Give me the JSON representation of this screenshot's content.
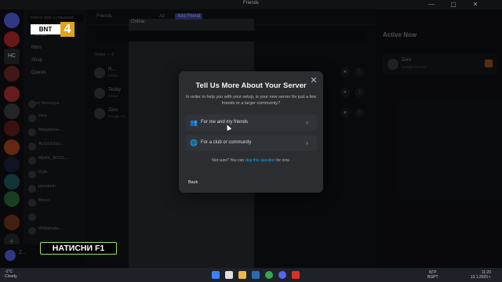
{
  "window": {
    "title": "Friends",
    "minimize": "—",
    "maximize": "▢",
    "close": "✕"
  },
  "server_rail": {
    "items": [
      "",
      "HC",
      "",
      "",
      "",
      "",
      "",
      "",
      "",
      "",
      "",
      "",
      "",
      "",
      ""
    ],
    "add": "+"
  },
  "sidebar": {
    "find_placeholder": "Find or start a conversati...",
    "nav": [
      "Friends",
      "Nitro",
      "Shop",
      "Quests"
    ],
    "dm_header": "Direct Messages",
    "dms": [
      {
        "name": "",
        "status": ""
      },
      {
        "name": "Zero",
        "status": ""
      },
      {
        "name": "Bloodemer...",
        "status": ""
      },
      {
        "name": "AUUUUUU...",
        "status": ""
      },
      {
        "name": "Mystic_BOUL...",
        "status": ""
      },
      {
        "name": "Oyte",
        "status": ""
      },
      {
        "name": "jasnamin",
        "status": ""
      },
      {
        "name": "Bloso",
        "status": ""
      },
      {
        "name": "",
        "status": ""
      },
      {
        "name": "Williamster...",
        "status": ""
      }
    ]
  },
  "user_panel": {
    "name": "Z..."
  },
  "topbar": {
    "friends": "Friends",
    "online": "Online",
    "all": "All",
    "add_friend": "Add Friend"
  },
  "friends": {
    "online_count": "Online — 3",
    "rows": [
      {
        "name": "R...",
        "status": "Online"
      },
      {
        "name": "Teddy",
        "status": "Online"
      },
      {
        "name": "Zero",
        "status": "Google Ch..."
      }
    ]
  },
  "active_now": {
    "title": "Active Now",
    "card": {
      "name": "Zero",
      "status": "Google Chrome"
    }
  },
  "modal": {
    "title": "Tell Us More About Your Server",
    "description": "In order to help you with your setup, is your new server for just a few friends or a larger community?",
    "options": [
      {
        "label": "For me and my friends",
        "icon": "👥"
      },
      {
        "label": "For a club or community",
        "icon": "🌐"
      }
    ],
    "note_prefix": "Not sure? You can ",
    "note_link": "skip this question",
    "note_suffix": " for now.",
    "back": "Back",
    "close": "✕",
    "chevron": "›"
  },
  "overlays": {
    "bnt_text": "BNT",
    "bnt_number": "4",
    "press_key": "НАТИСНИ F1"
  },
  "taskbar": {
    "weather_temp": "-1°C",
    "weather_desc": "Cloudy",
    "lang_top": "БГР",
    "lang_bottom": "BGPT",
    "time": "11:20",
    "date": "13.1.2025 г."
  },
  "colors": {
    "accent": "#5865f2",
    "link": "#00a8fc",
    "modal_bg": "#2b2d31",
    "bnt_orange": "#e0a31c",
    "f1_border": "#9de06b"
  }
}
